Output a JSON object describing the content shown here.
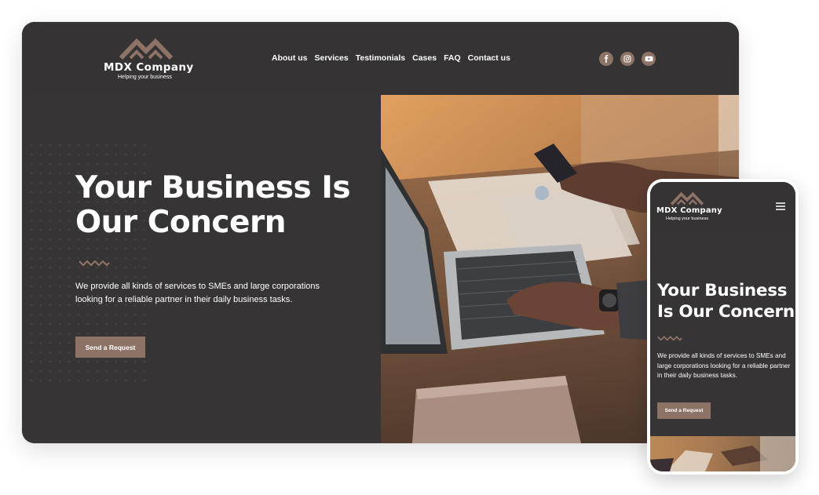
{
  "brand": {
    "name": "MDX Company",
    "tagline": "Helping your business"
  },
  "nav": {
    "items": [
      "About us",
      "Services",
      "Testimonials",
      "Cases",
      "FAQ",
      "Contact us"
    ]
  },
  "social": {
    "icons": [
      "facebook-icon",
      "instagram-icon",
      "youtube-icon"
    ]
  },
  "hero": {
    "title_line1": "Your Business Is",
    "title_line2": "Our Concern",
    "description": "We provide all kinds of services to SMEs and large corporations looking for a reliable partner in their daily business tasks.",
    "button_label": "Send a Request"
  },
  "mobile": {
    "title_line1": "Your Business",
    "title_line2": "Is Our Concern",
    "menu_icon": "hamburger-menu-icon"
  },
  "colors": {
    "background": "#353334",
    "accent": "#8d7266",
    "text": "#ffffff"
  }
}
